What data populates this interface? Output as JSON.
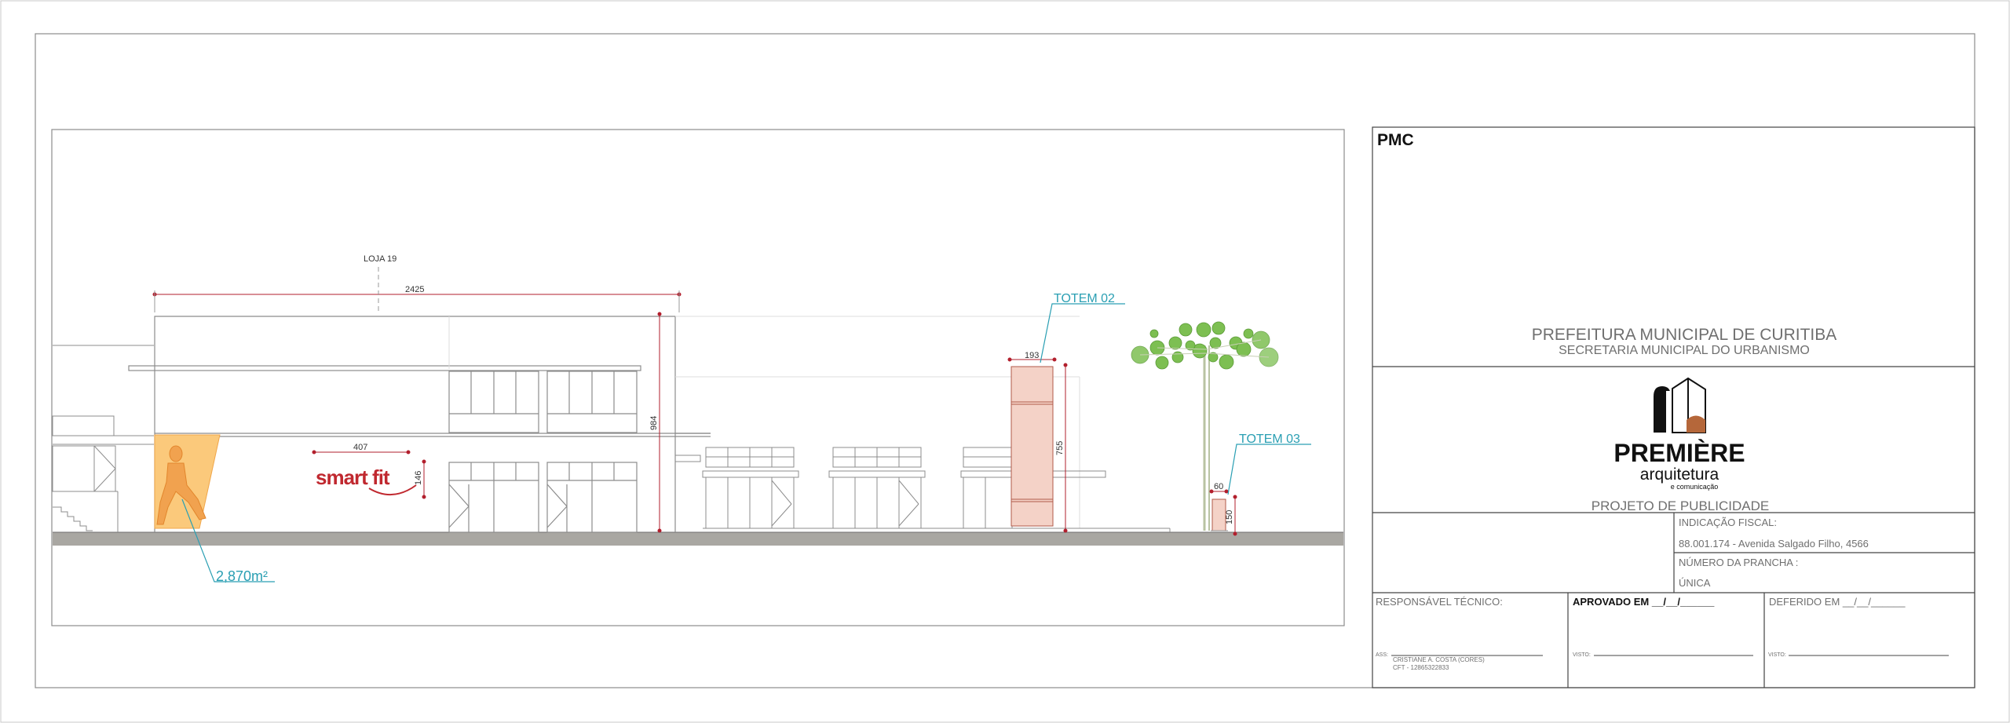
{
  "elevation": {
    "loja_label": "LOJA  19",
    "dim_total_width": "2425",
    "dim_height": "984",
    "dim_logo_width": "407",
    "dim_logo_height": "146",
    "logo_text": "smart fit",
    "area_label": "2,870m²",
    "totem_02_label": "TOTEM  02",
    "totem_02_width": "193",
    "totem_02_height": "755",
    "totem_03_label": "TOTEM  03",
    "totem_03_width": "60",
    "totem_03_height": "150"
  },
  "title_block": {
    "agency_code": "PMC",
    "prefeitura": "PREFEITURA MUNICIPAL DE CURITIBA",
    "secretaria": "SECRETARIA MUNICIPAL DO URBANISMO",
    "brand_name": "PREMIÈRE",
    "brand_sub": "arquitetura",
    "brand_sub2": "e comunicação",
    "project_type": "PROJETO DE PUBLICIDADE",
    "fiscal_label": "INDICAÇÃO FISCAL:",
    "fiscal_value": "88.001.174 - Avenida Salgado Filho, 4566",
    "prancha_label": "NÚMERO DA PRANCHA :",
    "prancha_value": "ÚNICA",
    "responsavel_label": "RESPONSÁVEL TÉCNICO:",
    "aprovado_label": "APROVADO EM __/__/______",
    "deferido_label": "DEFERIDO EM __/__/______",
    "ass_label": "ASS:",
    "responsavel_name": "CRISTIANE A. COSTA (CORES)",
    "responsavel_cft": "CFT - 12865322833",
    "visto_label": "VISTO:"
  },
  "colors": {
    "line": "#8c8c8c",
    "ground": "#a9a7a2",
    "totem_fill": "#f4d2c7",
    "totem_stroke": "#b05a4a",
    "area_fill": "#fbc97b",
    "figure_fill": "#f1a24f",
    "leader": "#2a9fb3",
    "dim_red": "#b21f2d",
    "logo_red": "#c0282f",
    "tree_green": "#7dbf52",
    "brand_brown": "#b5673a"
  }
}
